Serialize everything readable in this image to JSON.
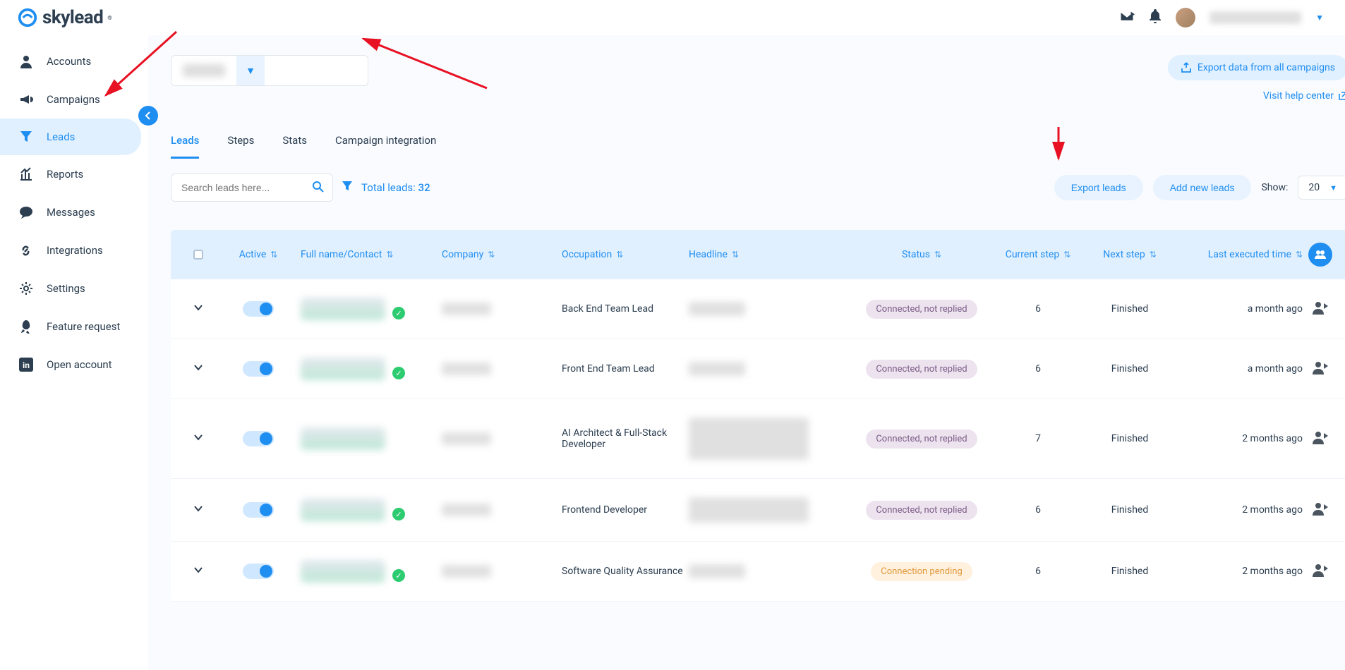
{
  "brand": "skylead",
  "header": {
    "export_all": "Export data from all campaigns",
    "help_link": "Visit help center"
  },
  "sidebar": {
    "items": [
      {
        "label": "Accounts"
      },
      {
        "label": "Campaigns"
      },
      {
        "label": "Leads"
      },
      {
        "label": "Reports"
      },
      {
        "label": "Messages"
      },
      {
        "label": "Integrations"
      },
      {
        "label": "Settings"
      },
      {
        "label": "Feature request"
      },
      {
        "label": "Open account"
      }
    ]
  },
  "tabs": {
    "leads": "Leads",
    "steps": "Steps",
    "stats": "Stats",
    "integration": "Campaign integration"
  },
  "search_placeholder": "Search leads here...",
  "total_leads_label": "Total leads:",
  "total_leads_value": "32",
  "buttons": {
    "export_leads": "Export leads",
    "add_leads": "Add new leads"
  },
  "show_label": "Show:",
  "show_value": "20",
  "columns": {
    "active": "Active",
    "name": "Full name/Contact",
    "company": "Company",
    "occupation": "Occupation",
    "headline": "Headline",
    "status": "Status",
    "current_step": "Current step",
    "next_step": "Next step",
    "last_exec": "Last executed time"
  },
  "status_labels": {
    "connected_not_replied": "Connected, not replied",
    "connection_pending": "Connection pending"
  },
  "rows": [
    {
      "occupation": "Back End Team Lead",
      "status": "connected_not_replied",
      "step": "6",
      "next": "Finished",
      "time": "a month ago",
      "verified": true
    },
    {
      "occupation": "Front End Team Lead",
      "status": "connected_not_replied",
      "step": "6",
      "next": "Finished",
      "time": "a month ago",
      "verified": true
    },
    {
      "occupation": "AI Architect & Full-Stack Developer",
      "status": "connected_not_replied",
      "step": "7",
      "next": "Finished",
      "time": "2 months ago",
      "verified": false
    },
    {
      "occupation": "Frontend Developer",
      "status": "connected_not_replied",
      "step": "6",
      "next": "Finished",
      "time": "2 months ago",
      "verified": true
    },
    {
      "occupation": "Software Quality Assurance",
      "status": "connection_pending",
      "step": "6",
      "next": "Finished",
      "time": "2 months ago",
      "verified": true
    }
  ]
}
